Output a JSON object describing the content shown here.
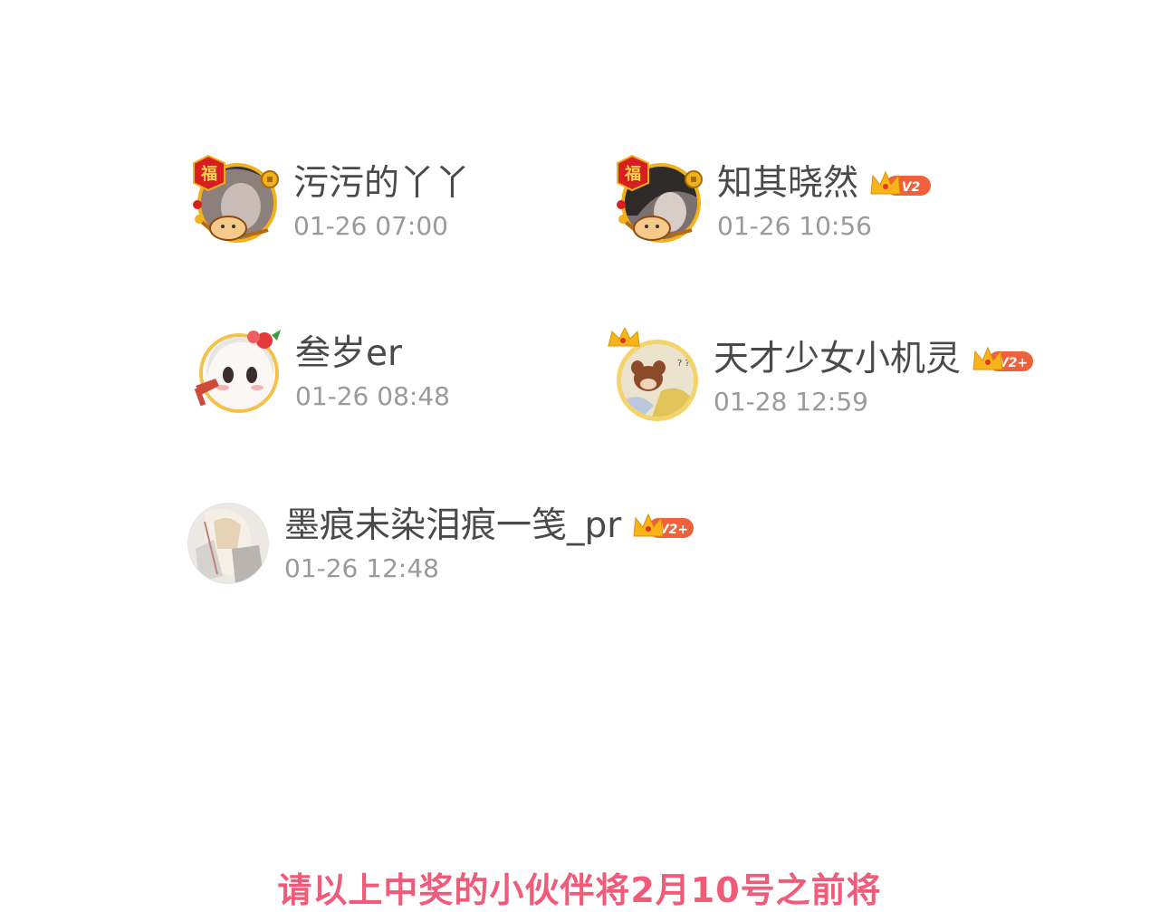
{
  "users": [
    {
      "name": "污污的丫丫",
      "time": "01-26 07:00",
      "vip": null
    },
    {
      "name": "知其晓然",
      "time": "01-26 10:56",
      "vip": "V2"
    },
    {
      "name": "叁岁er",
      "time": "01-26 08:48",
      "vip": null
    },
    {
      "name": "天才少女小机灵",
      "time": "01-28 12:59",
      "vip": "V2+"
    },
    {
      "name": "墨痕未染泪痕一笺_pr",
      "time": "01-26 12:48",
      "vip": "V2+"
    }
  ],
  "footer": {
    "text": "请以上中奖的小伙伴将2月10号之前将"
  },
  "colors": {
    "name": "#4a4a4a",
    "time": "#9a9a9a",
    "footer": "#ef5b78",
    "vip_badge": "#f0603a",
    "crown": "#f7b518"
  },
  "icons": {
    "vip": "crown-vip-badge-icon",
    "frame_fortune": "fortune-frame-icon",
    "frame_flower": "flower-frame-icon",
    "crown": "crown-icon"
  }
}
